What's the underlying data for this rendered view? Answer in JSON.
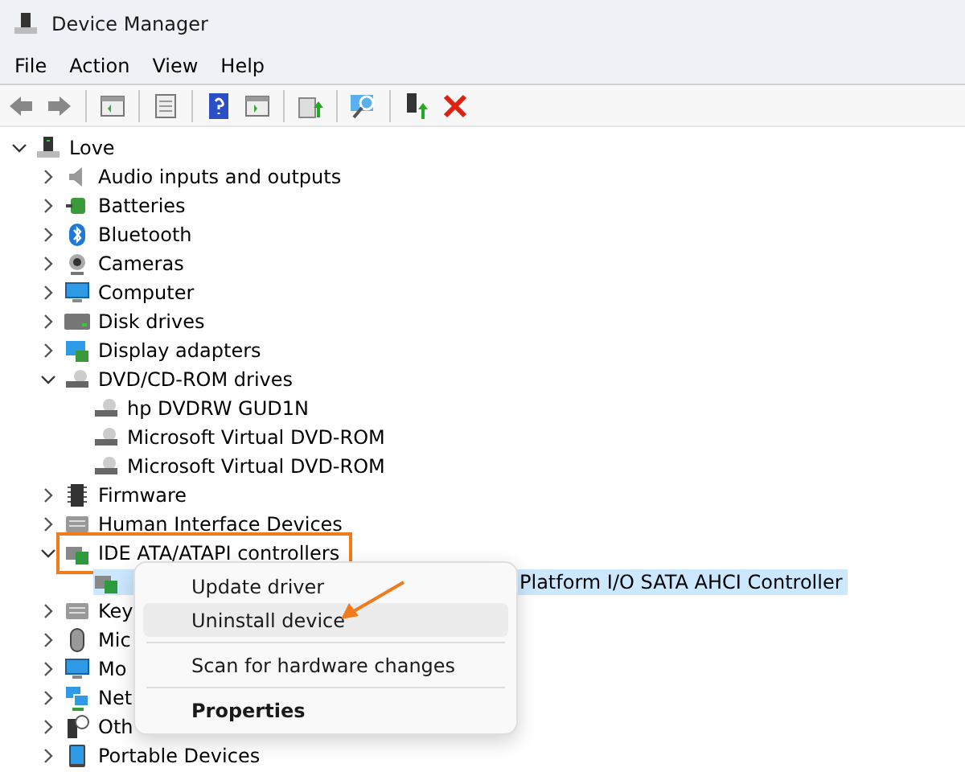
{
  "window": {
    "title": "Device Manager"
  },
  "menu_bar": [
    "File",
    "Action",
    "View",
    "Help"
  ],
  "tree": [
    {
      "label": "Love",
      "kind": "computer-tower",
      "expanded": true,
      "selected": false,
      "children": [
        {
          "label": "Audio inputs and outputs",
          "kind": "speaker",
          "expanded": false,
          "selected": false
        },
        {
          "label": "Batteries",
          "kind": "battery",
          "expanded": false,
          "selected": false
        },
        {
          "label": "Bluetooth",
          "kind": "bluetooth",
          "expanded": false,
          "selected": false
        },
        {
          "label": "Cameras",
          "kind": "camera",
          "expanded": false,
          "selected": false
        },
        {
          "label": "Computer",
          "kind": "monitor",
          "expanded": false,
          "selected": false
        },
        {
          "label": "Disk drives",
          "kind": "drive",
          "expanded": false,
          "selected": false
        },
        {
          "label": "Display adapters",
          "kind": "display-adapter",
          "expanded": false,
          "selected": false
        },
        {
          "label": "DVD/CD-ROM drives",
          "kind": "disc-drive",
          "expanded": true,
          "selected": false,
          "children": [
            {
              "label": "hp DVDRW GUD1N",
              "kind": "disc-drive",
              "selected": false
            },
            {
              "label": "Microsoft Virtual DVD-ROM",
              "kind": "disc-drive",
              "selected": false
            },
            {
              "label": "Microsoft Virtual DVD-ROM",
              "kind": "disc-drive",
              "selected": false
            }
          ]
        },
        {
          "label": "Firmware",
          "kind": "chip",
          "expanded": false,
          "selected": false
        },
        {
          "label": "Human Interface Devices",
          "kind": "keyboard",
          "expanded": false,
          "selected": false
        },
        {
          "label": "IDE ATA/ATAPI controllers",
          "kind": "controller",
          "expanded": true,
          "selected": false,
          "highlighted": true,
          "children": [
            {
              "label": "Platform I/O SATA AHCI Controller",
              "kind": "controller",
              "selected": true,
              "context_menu_open": true
            }
          ]
        },
        {
          "label": "Key",
          "kind": "keyboard",
          "expanded": false,
          "selected": false
        },
        {
          "label": "Mic",
          "kind": "mouse",
          "expanded": false,
          "selected": false
        },
        {
          "label": "Mo",
          "kind": "monitor",
          "expanded": false,
          "selected": false
        },
        {
          "label": "Net",
          "kind": "network",
          "expanded": false,
          "selected": false
        },
        {
          "label": "Oth",
          "kind": "unknown",
          "expanded": false,
          "selected": false
        },
        {
          "label": "Portable Devices",
          "kind": "tablet",
          "expanded": false,
          "selected": false
        }
      ]
    }
  ],
  "context_menu": [
    {
      "label": "Update driver",
      "hovered": false
    },
    {
      "label": "Uninstall device",
      "hovered": true,
      "annotated": true
    },
    {
      "label": "Scan for hardware changes",
      "hovered": false,
      "separator_before": true
    },
    {
      "label": "Properties",
      "hovered": false,
      "separator_before": true,
      "default": true
    }
  ]
}
